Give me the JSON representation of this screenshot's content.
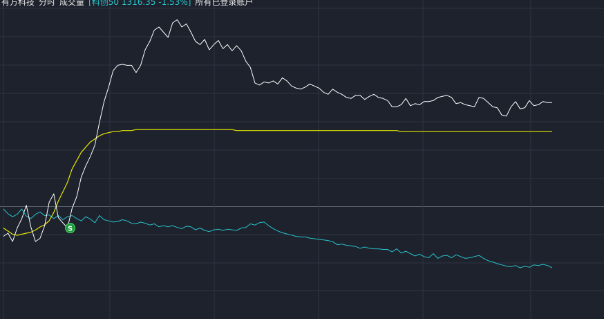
{
  "header": {
    "stock_name": "有方科技",
    "view_mode": "分时",
    "indicator": "成交量",
    "index_label": "[科创50 1316.35 -1.53%]",
    "accounts": "所有已登录账户"
  },
  "colors": {
    "background": "#1e222d",
    "grid": "#2e3442",
    "baseline": "#59606e",
    "price": "#ffffff",
    "avg": "#e6e600",
    "index": "#27c4cc",
    "signal": "#1a9c3e"
  },
  "chart_data": {
    "type": "line",
    "x_count": 121,
    "grid": true,
    "signal": {
      "label": "S",
      "x": 14,
      "series": "price"
    },
    "series": [
      {
        "key": "price",
        "values": [
          330,
          327,
          335,
          322,
          313,
          300,
          321,
          335,
          332,
          320,
          297,
          289,
          312,
          317,
          322,
          303,
          292,
          273,
          262,
          253,
          242,
          220,
          200,
          186,
          170,
          165,
          164,
          165,
          165,
          172,
          165,
          150,
          142,
          131,
          128,
          133,
          138,
          124,
          121,
          128,
          125,
          133,
          142,
          145,
          140,
          150,
          145,
          141,
          149,
          145,
          151,
          146,
          151,
          161,
          167,
          182,
          184,
          181,
          182,
          180,
          183,
          177,
          180,
          185,
          187,
          188,
          186,
          183,
          185,
          187,
          191,
          193,
          188,
          191,
          193,
          196,
          197,
          194,
          194,
          198,
          195,
          193,
          196,
          197,
          199,
          205,
          205,
          203,
          197,
          204,
          202,
          203,
          200,
          200,
          199,
          196,
          195,
          194,
          196,
          202,
          201,
          203,
          204,
          205,
          196,
          197,
          201,
          205,
          206,
          213,
          214,
          205,
          200,
          207,
          206,
          199,
          204,
          203,
          200,
          201,
          201
        ]
      },
      {
        "key": "avg",
        "values": [
          322,
          325,
          328,
          329,
          328,
          327,
          326,
          324,
          321,
          319,
          315,
          307,
          296,
          287,
          278,
          265,
          257,
          249,
          244,
          239,
          236,
          233,
          231,
          230,
          229,
          229,
          228,
          228,
          228,
          227,
          227,
          227,
          227,
          227,
          227,
          227,
          227,
          227,
          227,
          227,
          227,
          227,
          227,
          227,
          227,
          227,
          227,
          227,
          227,
          227,
          227,
          228,
          228,
          228,
          228,
          228,
          228,
          228,
          228,
          228,
          228,
          228,
          228,
          228,
          228,
          228,
          228,
          228,
          228,
          228,
          228,
          228,
          228,
          228,
          228,
          228,
          228,
          228,
          228,
          228,
          228,
          228,
          228,
          228,
          228,
          228,
          228,
          229,
          229,
          229,
          229,
          229,
          229,
          229,
          229,
          229,
          229,
          229,
          229,
          229,
          229,
          229,
          229,
          229,
          229,
          229,
          229,
          229,
          229,
          229,
          229,
          229,
          229,
          229,
          229,
          229,
          229,
          229,
          229,
          229,
          229
        ]
      },
      {
        "key": "index",
        "values": [
          -0.2,
          -0.28,
          -0.33,
          -0.29,
          -0.2,
          -0.32,
          -0.36,
          -0.29,
          -0.25,
          -0.31,
          -0.3,
          -0.36,
          -0.31,
          -0.38,
          -0.33,
          -0.31,
          -0.36,
          -0.4,
          -0.33,
          -0.37,
          -0.43,
          -0.31,
          -0.38,
          -0.4,
          -0.42,
          -0.41,
          -0.38,
          -0.4,
          -0.44,
          -0.45,
          -0.42,
          -0.44,
          -0.47,
          -0.45,
          -0.5,
          -0.48,
          -0.5,
          -0.48,
          -0.51,
          -0.53,
          -0.49,
          -0.5,
          -0.55,
          -0.52,
          -0.56,
          -0.58,
          -0.55,
          -0.54,
          -0.56,
          -0.54,
          -0.55,
          -0.56,
          -0.52,
          -0.51,
          -0.45,
          -0.47,
          -0.43,
          -0.42,
          -0.48,
          -0.53,
          -0.57,
          -0.6,
          -0.62,
          -0.64,
          -0.66,
          -0.67,
          -0.67,
          -0.69,
          -0.7,
          -0.71,
          -0.72,
          -0.73,
          -0.75,
          -0.8,
          -0.79,
          -0.81,
          -0.82,
          -0.83,
          -0.86,
          -0.84,
          -0.86,
          -0.87,
          -0.87,
          -0.88,
          -0.88,
          -0.92,
          -0.87,
          -0.94,
          -0.91,
          -0.95,
          -0.99,
          -0.96,
          -1.0,
          -1.02,
          -0.95,
          -1.03,
          -0.99,
          -0.98,
          -1.02,
          -0.97,
          -1.0,
          -1.03,
          -1.02,
          -1.0,
          -0.98,
          -1.03,
          -1.07,
          -1.09,
          -1.12,
          -1.14,
          -1.16,
          -1.17,
          -1.15,
          -1.19,
          -1.16,
          -1.18,
          -1.14,
          -1.15,
          -1.13,
          -1.15,
          -1.19
        ]
      }
    ]
  }
}
